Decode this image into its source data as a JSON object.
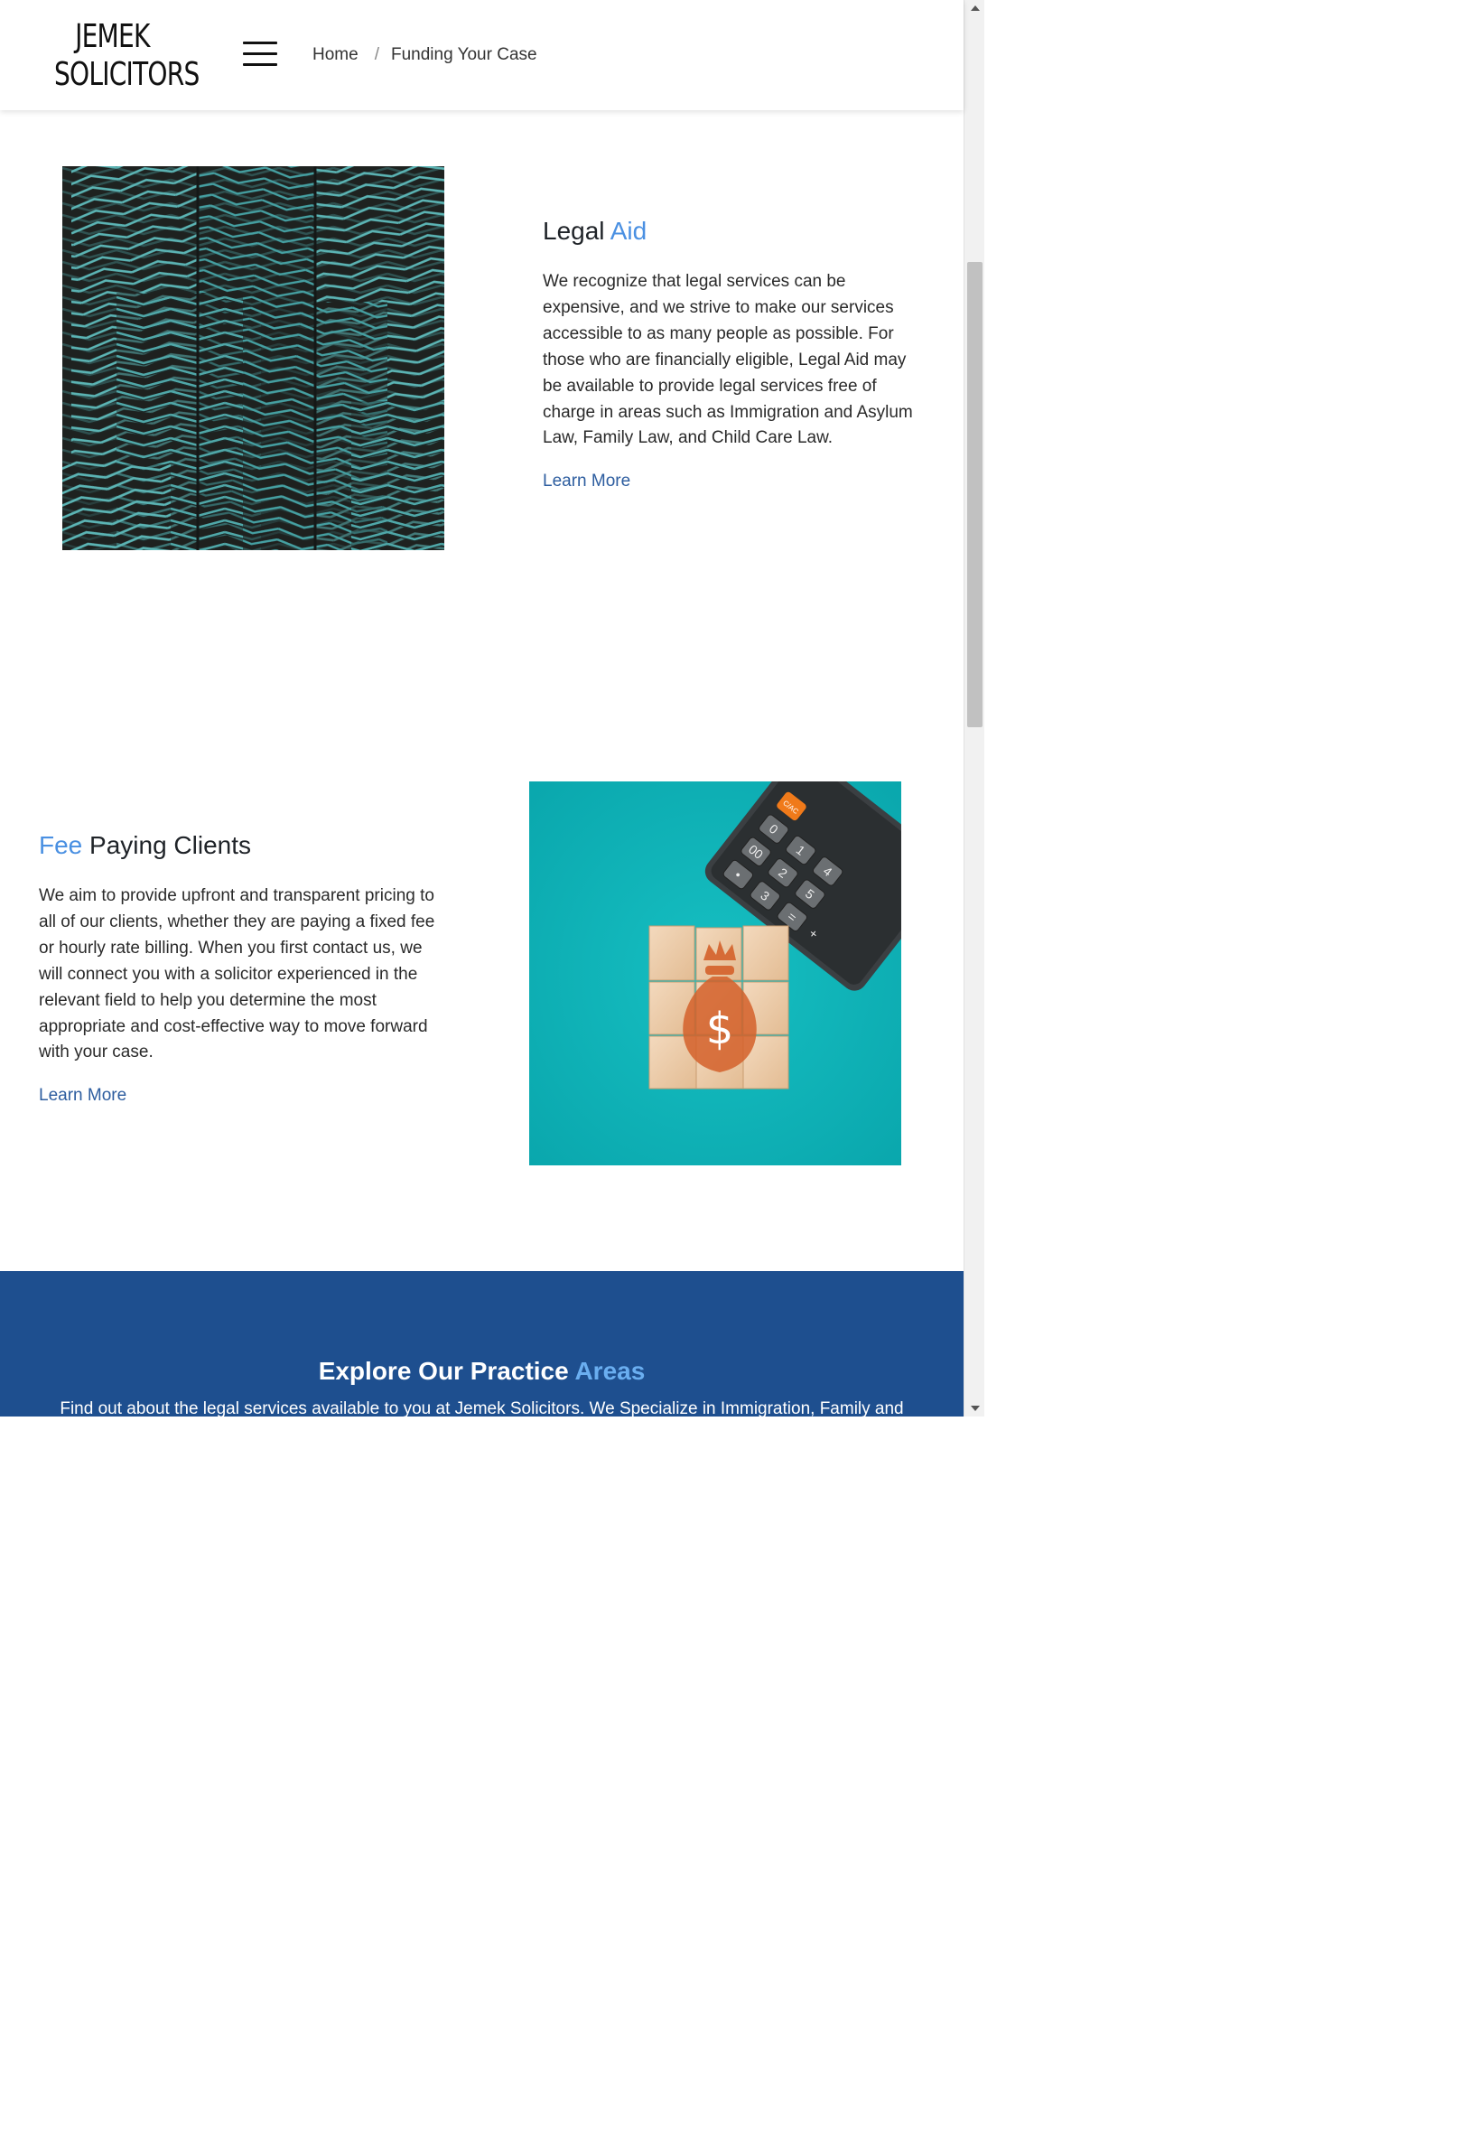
{
  "header": {
    "logo_line1": "JEMEK",
    "logo_line2": "SOLICITORS",
    "breadcrumb": {
      "home": "Home",
      "separator": "/",
      "current": "Funding Your Case"
    }
  },
  "sections": {
    "legal_aid": {
      "title_part1": "Legal",
      "title_part2": "Aid",
      "body": "We recognize that legal services can be expensive, and we strive to make our services accessible to as many people as possible. For those who are financially eligible, Legal Aid may be available to provide legal services free of charge in areas such as Immigration and Asylum Law, Family Law, and Child Care Law.",
      "link": "Learn More"
    },
    "fee_paying": {
      "title_part1": "Fee",
      "title_part2": "Paying Clients",
      "body": "We aim to provide upfront and transparent pricing to all of our clients, whether they are paying a fixed fee or hourly rate billing. When you first contact us, we will connect you with a solicitor experienced in the relevant field to help you determine the most appropriate and cost-effective way to move forward with your case.",
      "link": "Learn More"
    }
  },
  "practice_band": {
    "title_part1": "Explore Our Practice",
    "title_part2": "Areas",
    "subtitle": "Find out about the legal services available to you at Jemek Solicitors. We Specialize in Immigration, Family and"
  },
  "images": {
    "legal_aid": "abstract-teal-chevron-pattern",
    "fee_paying": "money-bag-blocks-with-calculator"
  },
  "calculator_keys": [
    "0",
    "1",
    "4",
    "00",
    "2",
    "5",
    "•",
    "3",
    "=",
    "+"
  ],
  "calculator_badge": "C/AC",
  "money_symbol": "$",
  "colors": {
    "accent": "#4a90e2",
    "link": "#2d5d9f",
    "band": "#1e4f8f",
    "teal": "#11b2b7"
  }
}
